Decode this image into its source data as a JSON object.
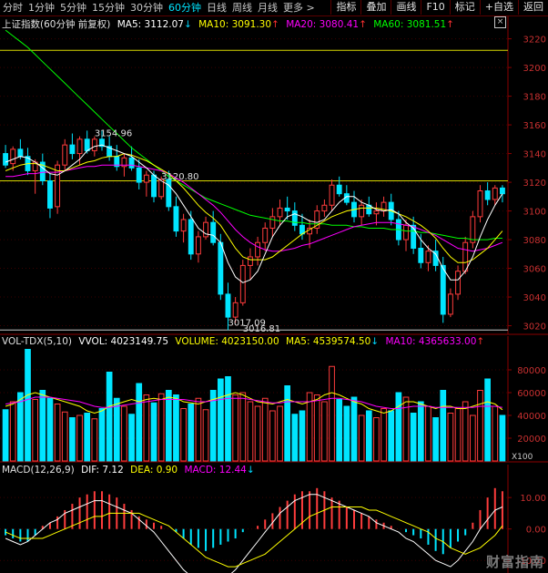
{
  "toolbar": {
    "tabs": [
      {
        "label": "分时"
      },
      {
        "label": "1分钟"
      },
      {
        "label": "5分钟"
      },
      {
        "label": "15分钟"
      },
      {
        "label": "30分钟"
      },
      {
        "label": "60分钟"
      },
      {
        "label": "日线"
      },
      {
        "label": "周线"
      },
      {
        "label": "月线"
      },
      {
        "label": "更多 >"
      }
    ],
    "active_tab": "60分钟",
    "buttons": [
      {
        "label": "指标"
      },
      {
        "label": "叠加"
      },
      {
        "label": "画线"
      },
      {
        "label": "F10"
      },
      {
        "label": "标记"
      },
      {
        "label": "+自选"
      },
      {
        "label": "返回"
      }
    ]
  },
  "price_info": {
    "name": "上证指数(60分钟 前复权)",
    "ma5": "MA5: 3112.07",
    "ma10": "MA10: 3091.30",
    "ma20": "MA20: 3080.41",
    "ma60": "MA60: 3081.51"
  },
  "volume_info": {
    "name": "VOL-TDX(5,10)",
    "vvol": "VVOL: 4023149.75",
    "volume": "VOLUME: 4023150.00",
    "ma5": "MA5: 4539574.50",
    "ma10": "MA10: 4365633.00"
  },
  "macd_info": {
    "name": "MACD(12,26,9)",
    "dif": "DIF: 7.12",
    "dea": "DEA: 0.90",
    "macd": "MACD: 12.44"
  },
  "colors": {
    "up": "#ff3c3c",
    "down": "#00e5ff",
    "ma5": "#ffffff",
    "ma10": "#ffff00",
    "ma20": "#ff00ff",
    "ma60": "#00ff00",
    "grid": "#3a0000",
    "axis": "#8b0000"
  },
  "watermark": "财富指南",
  "chart_data": [
    {
      "type": "candlestick",
      "title": "上证指数(60分钟 前复权)",
      "yticks": [
        3020,
        3040,
        3060,
        3080,
        3100,
        3120,
        3140,
        3160,
        3180,
        3200,
        3220
      ],
      "ylim": [
        3014,
        3228
      ],
      "ohlc": [
        [
          3140,
          3146,
          3130,
          3132
        ],
        [
          3133,
          3145,
          3128,
          3143
        ],
        [
          3143,
          3150,
          3136,
          3138
        ],
        [
          3138,
          3144,
          3125,
          3128
        ],
        [
          3128,
          3136,
          3112,
          3134
        ],
        [
          3134,
          3140,
          3118,
          3121
        ],
        [
          3121,
          3126,
          3095,
          3102
        ],
        [
          3103,
          3135,
          3098,
          3132
        ],
        [
          3132,
          3150,
          3128,
          3146
        ],
        [
          3146,
          3154,
          3136,
          3140
        ],
        [
          3140,
          3152,
          3132,
          3150
        ],
        [
          3150,
          3156,
          3140,
          3142
        ],
        [
          3142,
          3152,
          3138,
          3150
        ],
        [
          3150,
          3156,
          3142,
          3145
        ],
        [
          3145,
          3152,
          3135,
          3138
        ],
        [
          3138,
          3146,
          3128,
          3131
        ],
        [
          3131,
          3140,
          3124,
          3137
        ],
        [
          3137,
          3145,
          3128,
          3130
        ],
        [
          3130,
          3136,
          3115,
          3120
        ],
        [
          3120,
          3128,
          3110,
          3125
        ],
        [
          3125,
          3128,
          3106,
          3110
        ],
        [
          3110,
          3124,
          3108,
          3122
        ],
        [
          3122,
          3128,
          3100,
          3103
        ],
        [
          3103,
          3110,
          3082,
          3086
        ],
        [
          3086,
          3098,
          3078,
          3094
        ],
        [
          3094,
          3100,
          3066,
          3070
        ],
        [
          3070,
          3086,
          3064,
          3082
        ],
        [
          3082,
          3096,
          3080,
          3092
        ],
        [
          3092,
          3100,
          3076,
          3078
        ],
        [
          3078,
          3084,
          3038,
          3042
        ],
        [
          3042,
          3050,
          3017,
          3026
        ],
        [
          3026,
          3040,
          3022,
          3036
        ],
        [
          3036,
          3066,
          3034,
          3062
        ],
        [
          3062,
          3074,
          3052,
          3068
        ],
        [
          3068,
          3082,
          3062,
          3078
        ],
        [
          3078,
          3092,
          3072,
          3088
        ],
        [
          3088,
          3102,
          3082,
          3096
        ],
        [
          3096,
          3108,
          3090,
          3102
        ],
        [
          3102,
          3110,
          3094,
          3100
        ],
        [
          3100,
          3106,
          3086,
          3090
        ],
        [
          3090,
          3098,
          3080,
          3084
        ],
        [
          3084,
          3094,
          3074,
          3088
        ],
        [
          3088,
          3104,
          3084,
          3100
        ],
        [
          3100,
          3108,
          3096,
          3104
        ],
        [
          3104,
          3122,
          3100,
          3118
        ],
        [
          3118,
          3124,
          3110,
          3112
        ],
        [
          3112,
          3118,
          3104,
          3106
        ],
        [
          3106,
          3114,
          3092,
          3096
        ],
        [
          3096,
          3108,
          3090,
          3104
        ],
        [
          3104,
          3110,
          3096,
          3098
        ],
        [
          3098,
          3106,
          3090,
          3100
        ],
        [
          3100,
          3110,
          3096,
          3106
        ],
        [
          3106,
          3112,
          3090,
          3094
        ],
        [
          3094,
          3100,
          3076,
          3080
        ],
        [
          3080,
          3094,
          3072,
          3090
        ],
        [
          3090,
          3096,
          3070,
          3074
        ],
        [
          3074,
          3084,
          3060,
          3064
        ],
        [
          3064,
          3076,
          3058,
          3072
        ],
        [
          3072,
          3080,
          3058,
          3062
        ],
        [
          3062,
          3068,
          3022,
          3028
        ],
        [
          3028,
          3046,
          3026,
          3042
        ],
        [
          3042,
          3062,
          3038,
          3058
        ],
        [
          3058,
          3082,
          3056,
          3078
        ],
        [
          3078,
          3100,
          3074,
          3096
        ],
        [
          3096,
          3118,
          3092,
          3114
        ],
        [
          3114,
          3120,
          3104,
          3108
        ],
        [
          3108,
          3118,
          3104,
          3116
        ],
        [
          3116,
          3118,
          3106,
          3112
        ]
      ],
      "lines": {
        "ma5": [
          3134,
          3136,
          3138,
          3137,
          3134,
          3130,
          3126,
          3125,
          3128,
          3132,
          3136,
          3142,
          3145,
          3146,
          3144,
          3142,
          3140,
          3138,
          3134,
          3130,
          3125,
          3121,
          3118,
          3112,
          3104,
          3096,
          3088,
          3084,
          3083,
          3078,
          3064,
          3054,
          3050,
          3052,
          3058,
          3070,
          3082,
          3090,
          3096,
          3098,
          3096,
          3093,
          3092,
          3094,
          3100,
          3106,
          3110,
          3110,
          3106,
          3104,
          3101,
          3100,
          3101,
          3098,
          3092,
          3088,
          3080,
          3074,
          3070,
          3060,
          3052,
          3052,
          3058,
          3068,
          3082,
          3094,
          3104,
          3112
        ],
        "ma10": [
          3128,
          3130,
          3132,
          3133,
          3133,
          3132,
          3130,
          3128,
          3128,
          3130,
          3132,
          3134,
          3135,
          3137,
          3138,
          3138,
          3140,
          3139,
          3137,
          3135,
          3132,
          3129,
          3126,
          3121,
          3116,
          3110,
          3104,
          3099,
          3095,
          3090,
          3082,
          3074,
          3068,
          3066,
          3066,
          3066,
          3068,
          3072,
          3076,
          3080,
          3084,
          3087,
          3090,
          3093,
          3096,
          3098,
          3100,
          3101,
          3102,
          3102,
          3102,
          3101,
          3100,
          3098,
          3096,
          3093,
          3090,
          3086,
          3081,
          3074,
          3068,
          3064,
          3064,
          3066,
          3070,
          3074,
          3080,
          3086
        ],
        "ma20": [
          3124,
          3124,
          3125,
          3126,
          3126,
          3127,
          3127,
          3127,
          3128,
          3129,
          3130,
          3131,
          3131,
          3132,
          3132,
          3132,
          3132,
          3132,
          3131,
          3130,
          3129,
          3128,
          3126,
          3123,
          3120,
          3116,
          3112,
          3108,
          3104,
          3099,
          3093,
          3087,
          3082,
          3078,
          3075,
          3073,
          3072,
          3072,
          3073,
          3074,
          3076,
          3077,
          3079,
          3081,
          3083,
          3085,
          3087,
          3089,
          3090,
          3091,
          3092,
          3092,
          3092,
          3091,
          3090,
          3089,
          3087,
          3085,
          3083,
          3080,
          3077,
          3074,
          3073,
          3072,
          3073,
          3074,
          3076,
          3078
        ],
        "ma60": [
          3226,
          3222,
          3218,
          3214,
          3209,
          3204,
          3199,
          3194,
          3189,
          3184,
          3179,
          3174,
          3169,
          3164,
          3159,
          3154,
          3149,
          3144,
          3140,
          3136,
          3132,
          3128,
          3124,
          3121,
          3118,
          3115,
          3112,
          3109,
          3107,
          3105,
          3103,
          3101,
          3099,
          3097,
          3096,
          3095,
          3094,
          3093,
          3093,
          3092,
          3092,
          3091,
          3091,
          3091,
          3090,
          3090,
          3090,
          3089,
          3089,
          3088,
          3088,
          3088,
          3087,
          3087,
          3086,
          3086,
          3085,
          3085,
          3084,
          3083,
          3082,
          3081,
          3081,
          3080,
          3080,
          3080,
          3081,
          3081
        ]
      },
      "hlines": [
        3212,
        3121,
        3017
      ],
      "annotations": [
        {
          "text": "3154.96",
          "x": 12,
          "y": 3152
        },
        {
          "text": "3120.80",
          "x": 21,
          "y": 3122
        },
        {
          "text": "3017.09",
          "x": 30,
          "y": 3020
        },
        {
          "text": "3016.81",
          "x": 32,
          "y": 3016
        }
      ]
    },
    {
      "type": "bar",
      "title": "VOL-TDX(5,10)",
      "yticks": [
        20000,
        40000,
        60000,
        80000
      ],
      "yticklabels": [
        "20000",
        "40000",
        "60000",
        "80000"
      ],
      "ylim": [
        0,
        100000
      ],
      "unit_label": "X100",
      "volumes": [
        45000,
        52000,
        60000,
        98000,
        54000,
        62000,
        55000,
        50000,
        43000,
        38000,
        40000,
        42000,
        37000,
        46000,
        78000,
        55000,
        48000,
        41000,
        68000,
        58000,
        51000,
        59000,
        62000,
        58000,
        46000,
        50000,
        55000,
        45000,
        62000,
        72000,
        74000,
        58000,
        60000,
        52000,
        48000,
        55000,
        44000,
        48000,
        66000,
        41000,
        44000,
        60000,
        58000,
        52000,
        83000,
        54000,
        48000,
        56000,
        40000,
        44000,
        38000,
        46000,
        44000,
        60000,
        56000,
        42000,
        52000,
        48000,
        38000,
        62000,
        42000,
        46000,
        52000,
        40000,
        62000,
        72000,
        48000,
        40000
      ],
      "ma5": [
        48000,
        50000,
        54000,
        58000,
        60000,
        58000,
        56000,
        54000,
        52000,
        50000,
        48000,
        44000,
        42000,
        44000,
        48000,
        50000,
        52000,
        54000,
        52000,
        54000,
        55000,
        54000,
        56000,
        55000,
        52000,
        51000,
        50000,
        52000,
        54000,
        56000,
        58000,
        60000,
        58000,
        55000,
        52000,
        51000,
        50000,
        52000,
        54000,
        52000,
        50000,
        52000,
        54000,
        58000,
        60000,
        58000,
        55000,
        52000,
        50000,
        46000,
        44000,
        42000,
        44000,
        48000,
        52000,
        52000,
        50000,
        48000,
        46000,
        48000,
        48000,
        46000,
        46000,
        48000,
        50000,
        52000,
        50000,
        45000
      ],
      "ma10": [
        50000,
        51000,
        52000,
        54000,
        56000,
        56000,
        56000,
        55000,
        54000,
        53000,
        52000,
        50000,
        48000,
        47000,
        47000,
        48000,
        49000,
        50000,
        51000,
        52000,
        53000,
        54000,
        54000,
        54000,
        54000,
        53000,
        52000,
        52000,
        53000,
        54000,
        55000,
        55000,
        55000,
        54000,
        53000,
        52000,
        51000,
        51000,
        52000,
        52000,
        52000,
        52000,
        53000,
        54000,
        55000,
        55000,
        54000,
        53000,
        52000,
        50000,
        48000,
        47000,
        46000,
        46000,
        47000,
        48000,
        48000,
        48000,
        47000,
        47000,
        47000,
        47000,
        47000,
        47000,
        48000,
        48000,
        48000,
        47000
      ]
    },
    {
      "type": "bar",
      "title": "MACD(12,26,9)",
      "yticks": [
        -10,
        0,
        10
      ],
      "yticklabels": [
        "-10.00",
        "0.00",
        "10.00"
      ],
      "ylim": [
        -14,
        17
      ],
      "macd": [
        -2,
        -3,
        -4,
        -4,
        -2,
        1,
        2,
        4,
        6,
        8,
        10,
        11,
        12,
        12,
        11,
        10,
        8,
        6,
        4,
        3,
        2,
        1,
        0,
        -1,
        -3,
        -5,
        -6,
        -7,
        -6,
        -5,
        -4,
        -3,
        -1,
        0,
        1,
        3,
        5,
        7,
        9,
        11,
        12,
        12,
        13,
        12,
        10,
        9,
        7,
        6,
        5,
        4,
        3,
        2,
        1,
        0,
        -1,
        -2,
        -3,
        -5,
        -7,
        -8,
        -6,
        -4,
        -2,
        2,
        6,
        10,
        13,
        12
      ],
      "dif": [
        -3,
        -4,
        -5,
        -4,
        -2,
        0,
        2,
        3,
        5,
        6,
        7,
        8,
        9,
        9,
        8,
        7,
        6,
        5,
        3,
        1,
        -1,
        -4,
        -7,
        -10,
        -13,
        -15,
        -16,
        -17,
        -17,
        -16,
        -15,
        -13,
        -10,
        -7,
        -4,
        -1,
        2,
        5,
        7,
        9,
        10,
        11,
        11,
        10,
        9,
        8,
        7,
        6,
        5,
        4,
        2,
        1,
        0,
        -1,
        -3,
        -4,
        -6,
        -8,
        -10,
        -11,
        -12,
        -10,
        -7,
        -4,
        0,
        3,
        6,
        7
      ],
      "dea": [
        -1,
        -2,
        -3,
        -3,
        -3,
        -3,
        -2,
        -1,
        0,
        1,
        2,
        3,
        4,
        4,
        5,
        5,
        5,
        5,
        5,
        4,
        3,
        2,
        1,
        -1,
        -3,
        -5,
        -7,
        -9,
        -10,
        -11,
        -12,
        -12,
        -11,
        -10,
        -9,
        -8,
        -6,
        -4,
        -2,
        0,
        2,
        4,
        5,
        6,
        7,
        7,
        7,
        7,
        7,
        6,
        6,
        5,
        4,
        3,
        2,
        1,
        0,
        -1,
        -3,
        -4,
        -6,
        -7,
        -8,
        -7,
        -6,
        -4,
        -2,
        1
      ]
    }
  ]
}
